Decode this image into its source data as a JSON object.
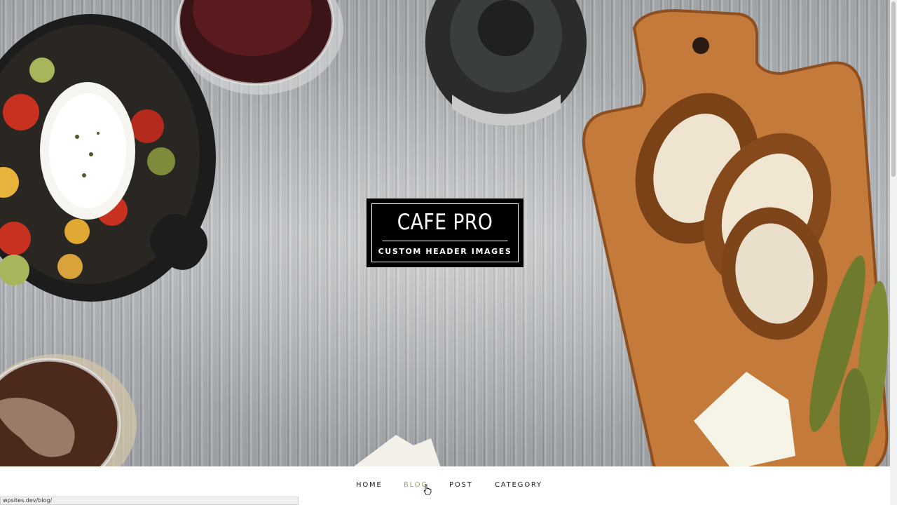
{
  "header": {
    "site_title": "CAFE PRO",
    "site_description": "CUSTOM HEADER IMAGES"
  },
  "nav": {
    "items": [
      {
        "label": "HOME"
      },
      {
        "label": "BLOG",
        "active": true
      },
      {
        "label": "POST"
      },
      {
        "label": "CATEGORY"
      }
    ]
  },
  "status_bar": {
    "url": "wpsites.dev/blog/"
  },
  "colors": {
    "nav_active": "#9aae5a",
    "badge_bg": "#000000",
    "text": "#222222"
  }
}
